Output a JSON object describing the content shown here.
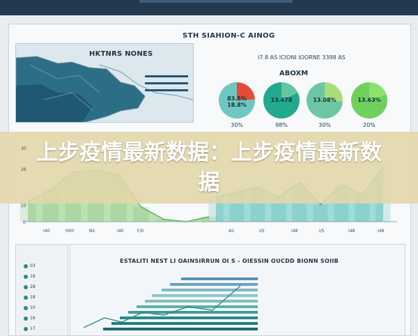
{
  "top": {
    "title": "STH SIAHION-C AINOG"
  },
  "map": {
    "title": "HKTNRS NONES"
  },
  "stats": {
    "subheading": "I7.8 AS ICIONI IOORNE 3398 AS",
    "heading": "ABOXM",
    "donuts": [
      {
        "label": "83.5%\n18.8%",
        "pct": "30%",
        "color_main": "#6fc7c1",
        "color_accent": "#e54a3a"
      },
      {
        "label": "13.478",
        "pct": "98%",
        "color_main": "#23a98d",
        "color_accent": "#62c7a0"
      },
      {
        "label": "13.08%",
        "pct": "30%",
        "color_main": "#6cc6a3",
        "color_accent": "#a9dd7a"
      },
      {
        "label": "13.63%",
        "pct": "20%",
        "color_main": "#6fd05c",
        "color_accent": "#8ee06e"
      }
    ]
  },
  "banner": {
    "text": "上步疫情最新数据：上步疫情最新数据"
  },
  "chart_data": {
    "type": "area",
    "y_ticks": [
      "30",
      "26",
      "10",
      "0"
    ],
    "x_ticks": [
      "I40",
      "H00",
      "NS",
      "I40",
      "F/II",
      "AS",
      "I/S",
      "I48",
      "I/S",
      "I48"
    ],
    "series": [
      {
        "values": [
          8,
          13,
          20,
          21,
          19,
          6,
          1,
          0,
          2
        ]
      },
      {
        "values": [
          10,
          12,
          14,
          10,
          16,
          7,
          15,
          11,
          22
        ]
      }
    ]
  },
  "lower": {
    "title": "ESTALITI NEST  LI OAINSIRRUN OI S - OIESSIN OUCDD  BIONN SOIIB",
    "legend": [
      "03",
      "18",
      "28",
      "18",
      "10",
      "16",
      "17"
    ]
  },
  "colors": {
    "banner_text": "#ffffff",
    "nav": "#23394f",
    "teal": "#2c8a8a"
  }
}
